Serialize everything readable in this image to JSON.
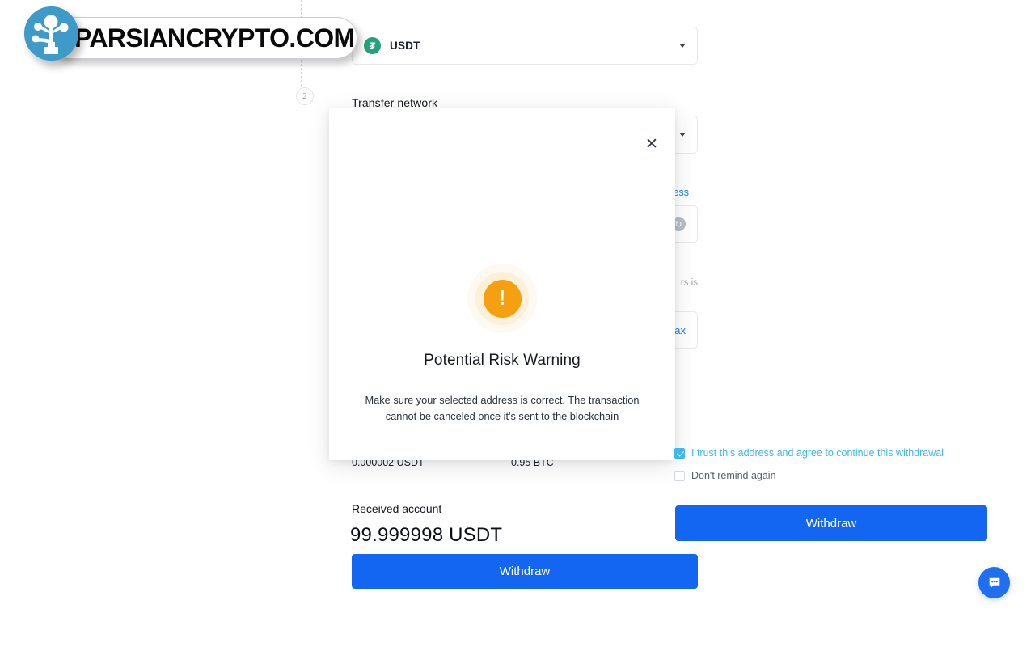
{
  "watermark": {
    "text": "PARSIANCRYPTO.COM",
    "logo_icon": "network-tree-icon",
    "logo_color": "#3e9ac8"
  },
  "background_form": {
    "step": {
      "number": "2"
    },
    "coin_select": {
      "value": "USDT",
      "icon": "tether-icon",
      "icon_glyph": "₮",
      "icon_color": "#26a17b",
      "caret_icon": "chevron-down-icon"
    },
    "network": {
      "label": "Transfer network",
      "value": "",
      "caret_icon": "chevron-down-icon"
    },
    "address": {
      "link_label": "ess",
      "field_value": "",
      "field_icon": "clock-history-icon"
    },
    "amount": {
      "hint": "rs is",
      "value": "",
      "max_label": "Max"
    },
    "fees": {
      "fee_value": "0.000002 USDT",
      "limit_value": "0.95 BTC"
    },
    "received": {
      "label": "Received account",
      "amount": "99.999998 USDT"
    },
    "withdraw_button": "Withdraw"
  },
  "modal": {
    "close_icon": "close-icon",
    "warning_icon": "exclamation-circle-icon",
    "warning_color": "#F5A010",
    "title": "Potential Risk Warning",
    "body": "Make sure your selected address is correct. The transaction cannot be canceled once it's sent to the blockchain",
    "checkboxes": [
      {
        "label": "I trust this address and agree to continue this withdrawal",
        "checked": true
      },
      {
        "label": "Don't remind again",
        "checked": false
      }
    ],
    "confirm_button": "Withdraw",
    "accent_color": "#1266f1",
    "checkbox_color": "#3cb7f2"
  },
  "chat_widget": {
    "icon": "chat-bubble-icon"
  }
}
